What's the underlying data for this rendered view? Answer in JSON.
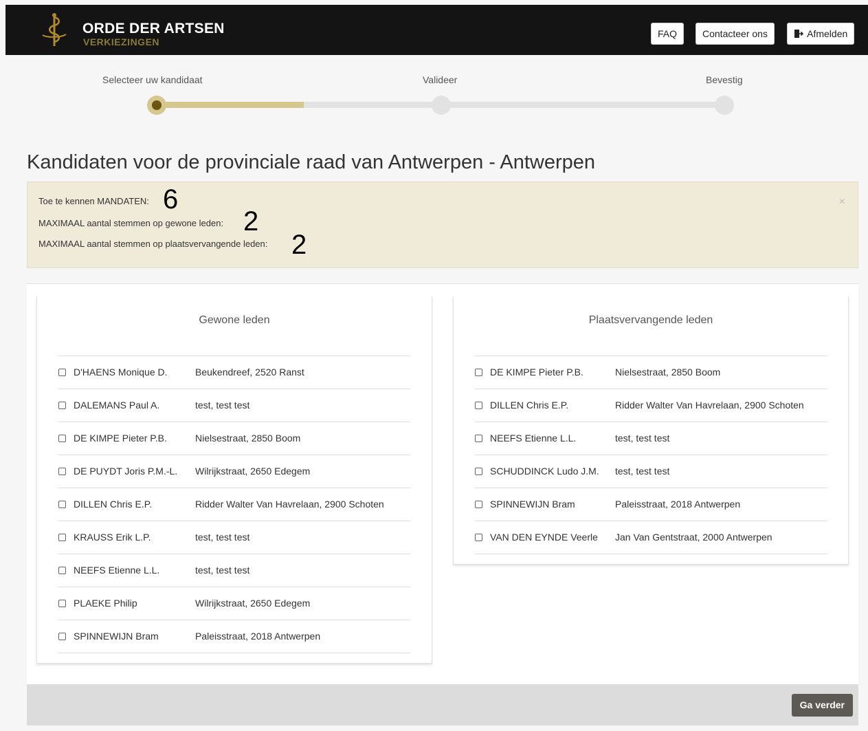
{
  "header": {
    "logo_title": "ORDE DER ARTSEN",
    "logo_subtitle": "VERKIEZINGEN",
    "faq_label": "FAQ",
    "contact_label": "Contacteer ons",
    "logout_label": "Afmelden",
    "logout_icon": "logout-icon",
    "background_color": "#141414",
    "gold_color": "#8a7a3a"
  },
  "stepper": {
    "steps": [
      "Selecteer uw kandidaat",
      "Valideer",
      "Bevestig"
    ],
    "current_step": 1,
    "progress_fraction": 0.26,
    "accent_color": "#d6c78e"
  },
  "page": {
    "title": "Kandidaten voor de provinciale raad van Antwerpen - Antwerpen"
  },
  "alert": {
    "mandates_label": "Toe te kennen MANDATEN:",
    "mandates_value": "6",
    "regular_label": "MAXIMAAL aantal stemmen op gewone leden:",
    "regular_value": "2",
    "substitute_label": "MAXIMAAL aantal stemmen op plaatsvervangende leden:",
    "substitute_value": "2",
    "close_icon": "close-icon",
    "close_glyph": "×",
    "background_color": "#f0ebd9"
  },
  "regular": {
    "title": "Gewone leden",
    "candidates": [
      {
        "name": "D'HAENS Monique D.",
        "address": "Beukendreef, 2520 Ranst"
      },
      {
        "name": "DALEMANS Paul A.",
        "address": "test, test test"
      },
      {
        "name": "DE KIMPE Pieter P.B.",
        "address": "Nielsestraat, 2850 Boom"
      },
      {
        "name": "DE PUYDT Joris P.M.-L.",
        "address": "Wilrijkstraat, 2650 Edegem"
      },
      {
        "name": "DILLEN Chris E.P.",
        "address": "Ridder Walter Van Havrelaan, 2900 Schoten"
      },
      {
        "name": "KRAUSS Erik L.P.",
        "address": "test, test test"
      },
      {
        "name": "NEEFS Etienne L.L.",
        "address": "test, test test"
      },
      {
        "name": "PLAEKE Philip",
        "address": "Wilrijkstraat, 2650 Edegem"
      },
      {
        "name": "SPINNEWIJN Bram",
        "address": "Paleisstraat, 2018 Antwerpen"
      }
    ]
  },
  "substitute": {
    "title": "Plaatsvervangende leden",
    "candidates": [
      {
        "name": "DE KIMPE Pieter P.B.",
        "address": "Nielsestraat, 2850 Boom"
      },
      {
        "name": "DILLEN Chris E.P.",
        "address": "Ridder Walter Van Havrelaan, 2900 Schoten"
      },
      {
        "name": "NEEFS Etienne L.L.",
        "address": "test, test test"
      },
      {
        "name": "SCHUDDINCK Ludo J.M.",
        "address": "test, test test"
      },
      {
        "name": "SPINNEWIJN Bram",
        "address": "Paleisstraat, 2018 Antwerpen"
      },
      {
        "name": "VAN DEN EYNDE Veerle",
        "address": "Jan Van Gentstraat, 2000 Antwerpen"
      }
    ]
  },
  "footer": {
    "next_label": "Ga verder",
    "button_color": "#5d5a55"
  }
}
